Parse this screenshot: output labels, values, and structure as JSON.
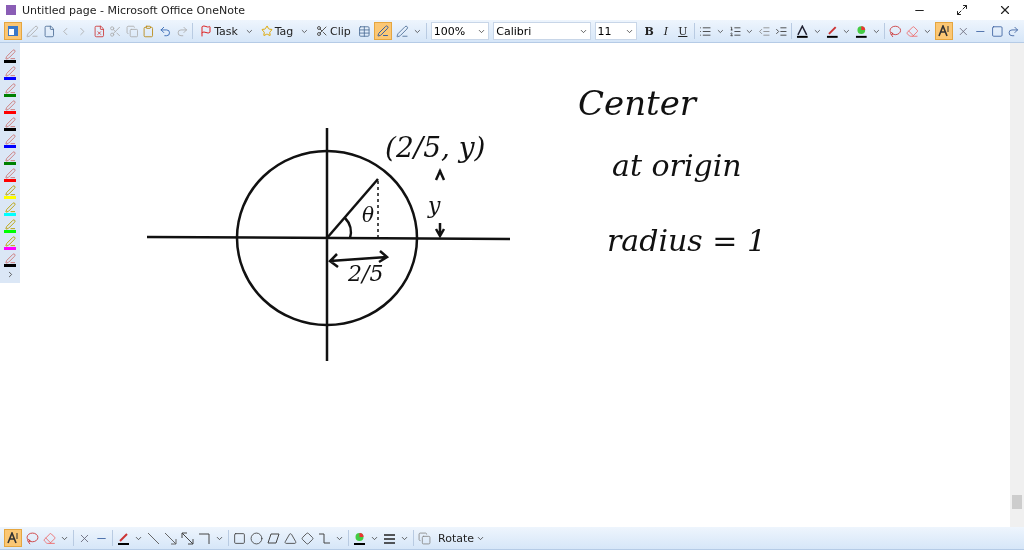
{
  "window": {
    "title": "Untitled page - Microsoft Office OneNote"
  },
  "toolbar": {
    "task_button": "Task",
    "tag_button": "Tag",
    "clip_button": "Clip",
    "zoom": "100%",
    "font": "Calibri",
    "font_size": "11",
    "bold": "B",
    "italic": "I",
    "underline": "U",
    "type_mode_active": true,
    "pen_mode_active": true,
    "page_view_active": true
  },
  "pens": [
    {
      "color": "#000000"
    },
    {
      "color": "#0000ff"
    },
    {
      "color": "#008000"
    },
    {
      "color": "#ff0000"
    },
    {
      "color": "#000000"
    },
    {
      "color": "#0000ff"
    },
    {
      "color": "#008000"
    },
    {
      "color": "#ff0000"
    },
    {
      "color": "#ffff00"
    },
    {
      "color": "#00ffff"
    },
    {
      "color": "#00ff00"
    },
    {
      "color": "#ff00ff"
    },
    {
      "color": "#000000"
    }
  ],
  "notes": [
    {
      "text": "Center"
    },
    {
      "text": "at origin"
    },
    {
      "text": "radius = 1"
    },
    {
      "text": "(2/5, y)"
    },
    {
      "text": "θ"
    },
    {
      "text": "y"
    },
    {
      "text": "2/5"
    }
  ],
  "drawing_toolbar": {
    "rotate_button": "Rotate",
    "type_mode_active": true
  }
}
